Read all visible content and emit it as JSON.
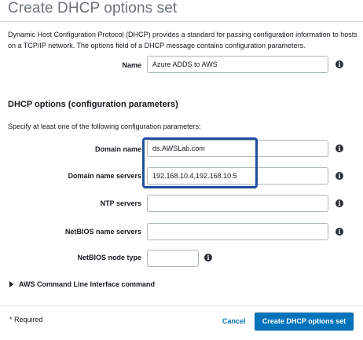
{
  "header": {
    "title": "Create DHCP options set"
  },
  "description": "Dynamic Host Configuration Protocol (DHCP) provides a standard for passing configuration information to hosts on a TCP/IP network. The options field of a DHCP message contains configuration parameters.",
  "name_field": {
    "label": "Name",
    "value": "Azure ADDS to AWS"
  },
  "dhcp_options": {
    "title": "DHCP options (configuration parameters)",
    "subtitle": "Specify at least one of the following configuration parameters:",
    "fields": {
      "domain_name": {
        "label": "Domain name",
        "value": "ds.AWSLab.com"
      },
      "domain_name_servers": {
        "label": "Domain name servers",
        "value": "192.168.10.4,192.168.10.5"
      },
      "ntp_servers": {
        "label": "NTP servers",
        "value": ""
      },
      "netbios_name_servers": {
        "label": "NetBIOS name servers",
        "value": ""
      },
      "netbios_node_type": {
        "label": "NetBIOS node type",
        "value": ""
      }
    }
  },
  "cli_section": {
    "label": "AWS Command Line Interface command"
  },
  "footer": {
    "required_note": "* Required",
    "cancel_label": "Cancel",
    "submit_label": "Create DHCP options set"
  },
  "icons": {
    "info": "info-icon"
  },
  "colors": {
    "primary": "#0073bb",
    "highlight": "#1f4ea0"
  }
}
